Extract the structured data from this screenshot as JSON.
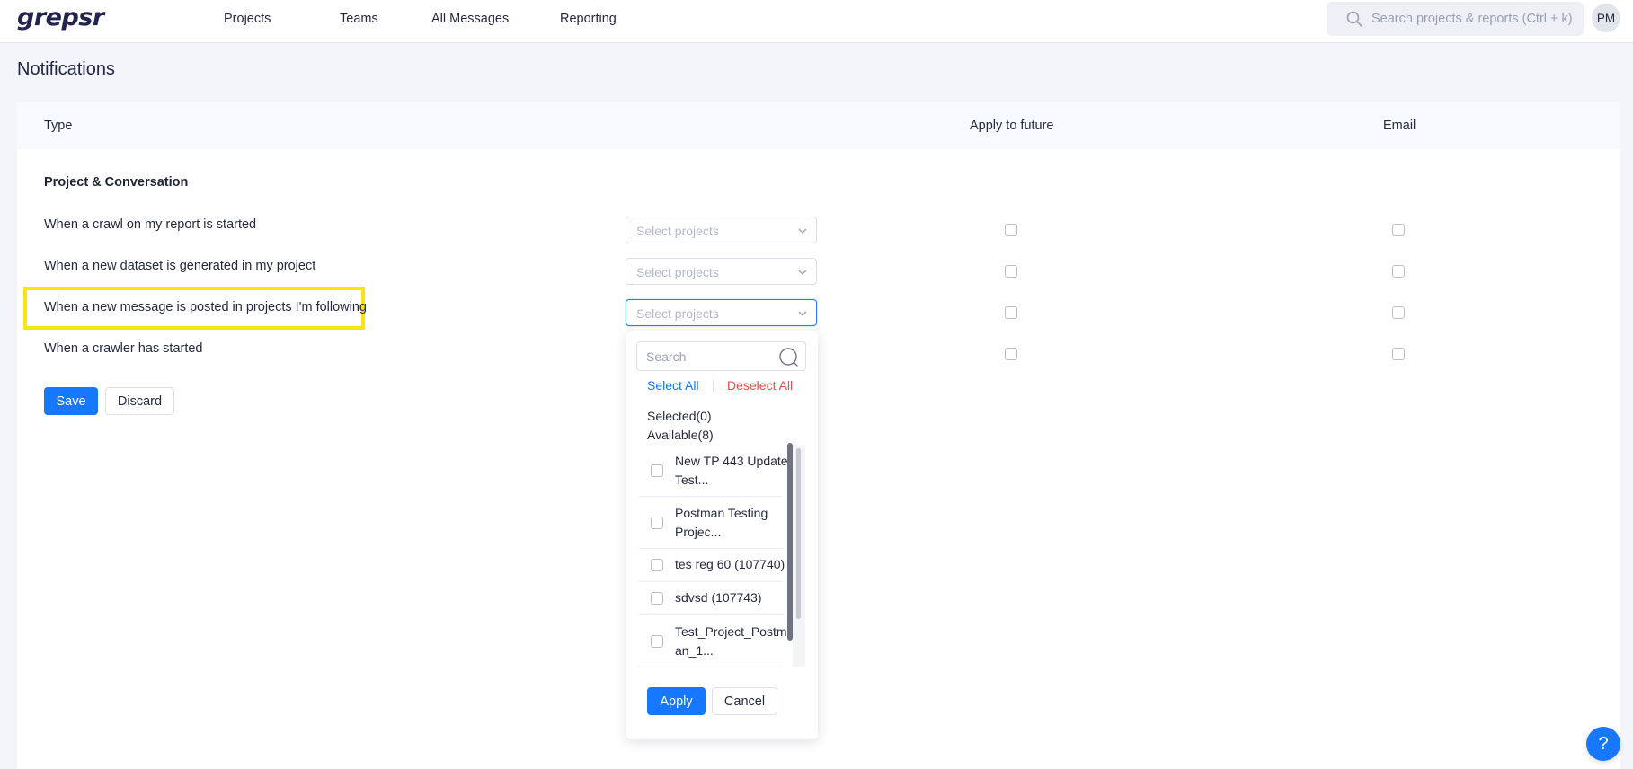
{
  "app": {
    "logo": "grepsr"
  },
  "nav": {
    "items": [
      "Projects",
      "Teams",
      "All Messages",
      "Reporting"
    ]
  },
  "search": {
    "placeholder": "Search projects & reports (Ctrl + k)"
  },
  "user": {
    "initials": "PM"
  },
  "page": {
    "title": "Notifications"
  },
  "table": {
    "columns": {
      "type": "Type",
      "apply_future": "Apply to future",
      "email": "Email"
    },
    "section": "Project & Conversation",
    "rows": [
      {
        "label": "When a crawl on my report is started",
        "select_placeholder": "Select projects",
        "apply_future": false,
        "email": false
      },
      {
        "label": "When a new dataset is generated in my project",
        "select_placeholder": "Select projects",
        "apply_future": false,
        "email": false
      },
      {
        "label": "When a new message is posted in projects I'm following",
        "select_placeholder": "Select projects",
        "apply_future": false,
        "email": false
      },
      {
        "label": "When a crawler has started",
        "apply_future": false,
        "email": false
      }
    ]
  },
  "actions": {
    "save": "Save",
    "discard": "Discard"
  },
  "dropdown": {
    "search_placeholder": "Search",
    "select_all": "Select All",
    "deselect_all": "Deselect All",
    "selected": "Selected(0)",
    "available": "Available(8)",
    "options": [
      {
        "label": "New TP 443 Update Test...",
        "checked": false
      },
      {
        "label": "Postman Testing Projec...",
        "checked": false
      },
      {
        "label": "tes reg 60 (107740)",
        "checked": false
      },
      {
        "label": "sdvsd (107743)",
        "checked": false
      },
      {
        "label": "Test_Project_Postman_1...",
        "checked": false
      }
    ],
    "apply": "Apply",
    "cancel": "Cancel"
  },
  "help": {
    "label": "?"
  },
  "colors": {
    "primary": "#1677ff",
    "danger": "#f5484b",
    "highlight": "#f7e516",
    "logo": "#23244e"
  }
}
